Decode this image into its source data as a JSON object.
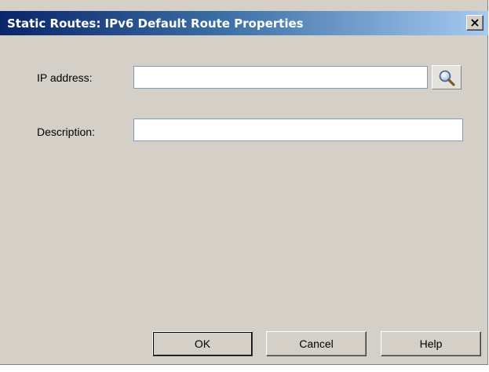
{
  "window": {
    "title": "Static Routes: IPv6 Default Route Properties",
    "close_glyph": "×",
    "close_icon": "close-icon"
  },
  "form": {
    "ip_label": "IP address:",
    "ip_value": "",
    "browse_icon": "magnifier-icon",
    "description_label": "Description:",
    "description_value": ""
  },
  "buttons": {
    "ok": "OK",
    "cancel": "Cancel",
    "help": "Help"
  }
}
